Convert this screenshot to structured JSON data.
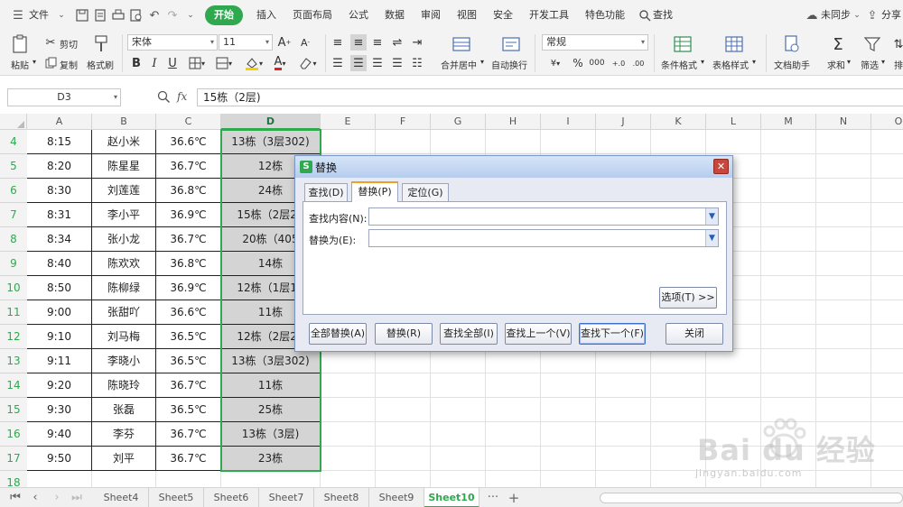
{
  "menubar": {
    "file_label": "文件",
    "tabs": [
      "开始",
      "插入",
      "页面布局",
      "公式",
      "数据",
      "审阅",
      "视图",
      "安全",
      "开发工具",
      "特色功能"
    ],
    "active_tab": "开始",
    "search_label": "查找",
    "sync_label": "未同步",
    "share_label": "分享",
    "accent_color": "#2fa84f"
  },
  "toolbar": {
    "paste_label": "粘贴",
    "cut_label": "剪切",
    "copy_label": "复制",
    "format_painter_label": "格式刷",
    "font_name": "宋体",
    "font_size": "11",
    "merge_center_label": "合并居中",
    "wrap_text_label": "自动换行",
    "number_format": "常规",
    "conditional_format_label": "条件格式",
    "table_style_label": "表格样式",
    "doc_helper_label": "文档助手",
    "sum_label": "求和",
    "filter_label": "筛选",
    "sort_label": "排"
  },
  "formulabar": {
    "name_box": "D3",
    "fx_label": "fx",
    "formula": "15栋（2层)"
  },
  "grid": {
    "columns": [
      "A",
      "B",
      "C",
      "D",
      "E",
      "F",
      "G",
      "H",
      "I",
      "J",
      "K",
      "L",
      "M",
      "N",
      "O"
    ],
    "rows": [
      {
        "num": "4",
        "a": "8:15",
        "b": "赵小米",
        "c": "36.6℃",
        "d": "13栋（3层302)"
      },
      {
        "num": "5",
        "a": "8:20",
        "b": "陈星星",
        "c": "36.7℃",
        "d": "12栋"
      },
      {
        "num": "6",
        "a": "8:30",
        "b": "刘莲莲",
        "c": "36.8℃",
        "d": "24栋"
      },
      {
        "num": "7",
        "a": "8:31",
        "b": "李小平",
        "c": "36.9℃",
        "d": "15栋（2层20"
      },
      {
        "num": "8",
        "a": "8:34",
        "b": "张小龙",
        "c": "36.7℃",
        "d": "20栋（405"
      },
      {
        "num": "9",
        "a": "8:40",
        "b": "陈欢欢",
        "c": "36.8℃",
        "d": "14栋"
      },
      {
        "num": "10",
        "a": "8:50",
        "b": "陈柳绿",
        "c": "36.9℃",
        "d": "12栋（1层10"
      },
      {
        "num": "11",
        "a": "9:00",
        "b": "张甜吖",
        "c": "36.6℃",
        "d": "11栋"
      },
      {
        "num": "12",
        "a": "9:10",
        "b": "刘马梅",
        "c": "36.5℃",
        "d": "12栋（2层20"
      },
      {
        "num": "13",
        "a": "9:11",
        "b": "李晓小",
        "c": "36.5℃",
        "d": "13栋（3层302)"
      },
      {
        "num": "14",
        "a": "9:20",
        "b": "陈晓玲",
        "c": "36.7℃",
        "d": "11栋"
      },
      {
        "num": "15",
        "a": "9:30",
        "b": "张磊",
        "c": "36.5℃",
        "d": "25栋"
      },
      {
        "num": "16",
        "a": "9:40",
        "b": "李芬",
        "c": "36.7℃",
        "d": "13栋（3层)"
      },
      {
        "num": "17",
        "a": "9:50",
        "b": "刘平",
        "c": "36.7℃",
        "d": "23栋"
      },
      {
        "num": "18",
        "a": "",
        "b": "",
        "c": "",
        "d": ""
      }
    ]
  },
  "sheets": {
    "tabs": [
      "Sheet4",
      "Sheet5",
      "Sheet6",
      "Sheet7",
      "Sheet8",
      "Sheet9",
      "Sheet10"
    ],
    "active": "Sheet10",
    "more_label": "···",
    "add_label": "+"
  },
  "dialog": {
    "title": "替换",
    "logo_label": "S",
    "close_label": "✕",
    "tabs": [
      "查找(D)",
      "替换(P)",
      "定位(G)"
    ],
    "active_tab": "替换(P)",
    "find_label": "查找内容(N):",
    "find_value": "",
    "replace_label": "替换为(E):",
    "replace_value": "",
    "options_label": "选项(T) >>",
    "buttons": {
      "replace_all": "全部替换(A)",
      "replace": "替换(R)",
      "find_all": "查找全部(I)",
      "find_prev": "查找上一个(V)",
      "find_next": "查找下一个(F)",
      "close": "关闭"
    }
  },
  "watermark": {
    "brand": "Bai du 经验",
    "url": "jingyan.baidu.com"
  }
}
